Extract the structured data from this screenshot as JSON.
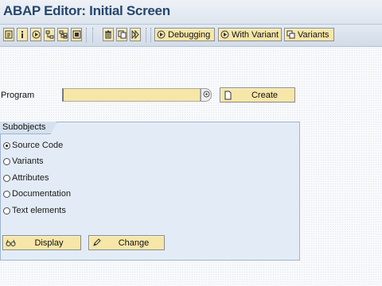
{
  "window": {
    "title": "ABAP Editor: Initial Screen"
  },
  "toolbar": {
    "icons": [
      "activate-icon",
      "info-icon",
      "test-icon",
      "hierarchy-icon",
      "where-used-icon",
      "display-object-list-icon",
      "delete-icon",
      "copy-icon",
      "execute-icon"
    ],
    "debugging_label": "Debugging",
    "with_variant_label": "With Variant",
    "variants_label": "Variants"
  },
  "program": {
    "label": "Program",
    "value": "",
    "create_label": "Create"
  },
  "subobjects": {
    "title": "Subobjects",
    "options": [
      "Source Code",
      "Variants",
      "Attributes",
      "Documentation",
      "Text elements"
    ],
    "selected": "Source Code"
  },
  "actions": {
    "display_label": "Display",
    "change_label": "Change"
  },
  "colors": {
    "title": "#26466e",
    "button": "#f6e6a8",
    "input": "#f7e7a6",
    "group": "#e3ecf6"
  }
}
